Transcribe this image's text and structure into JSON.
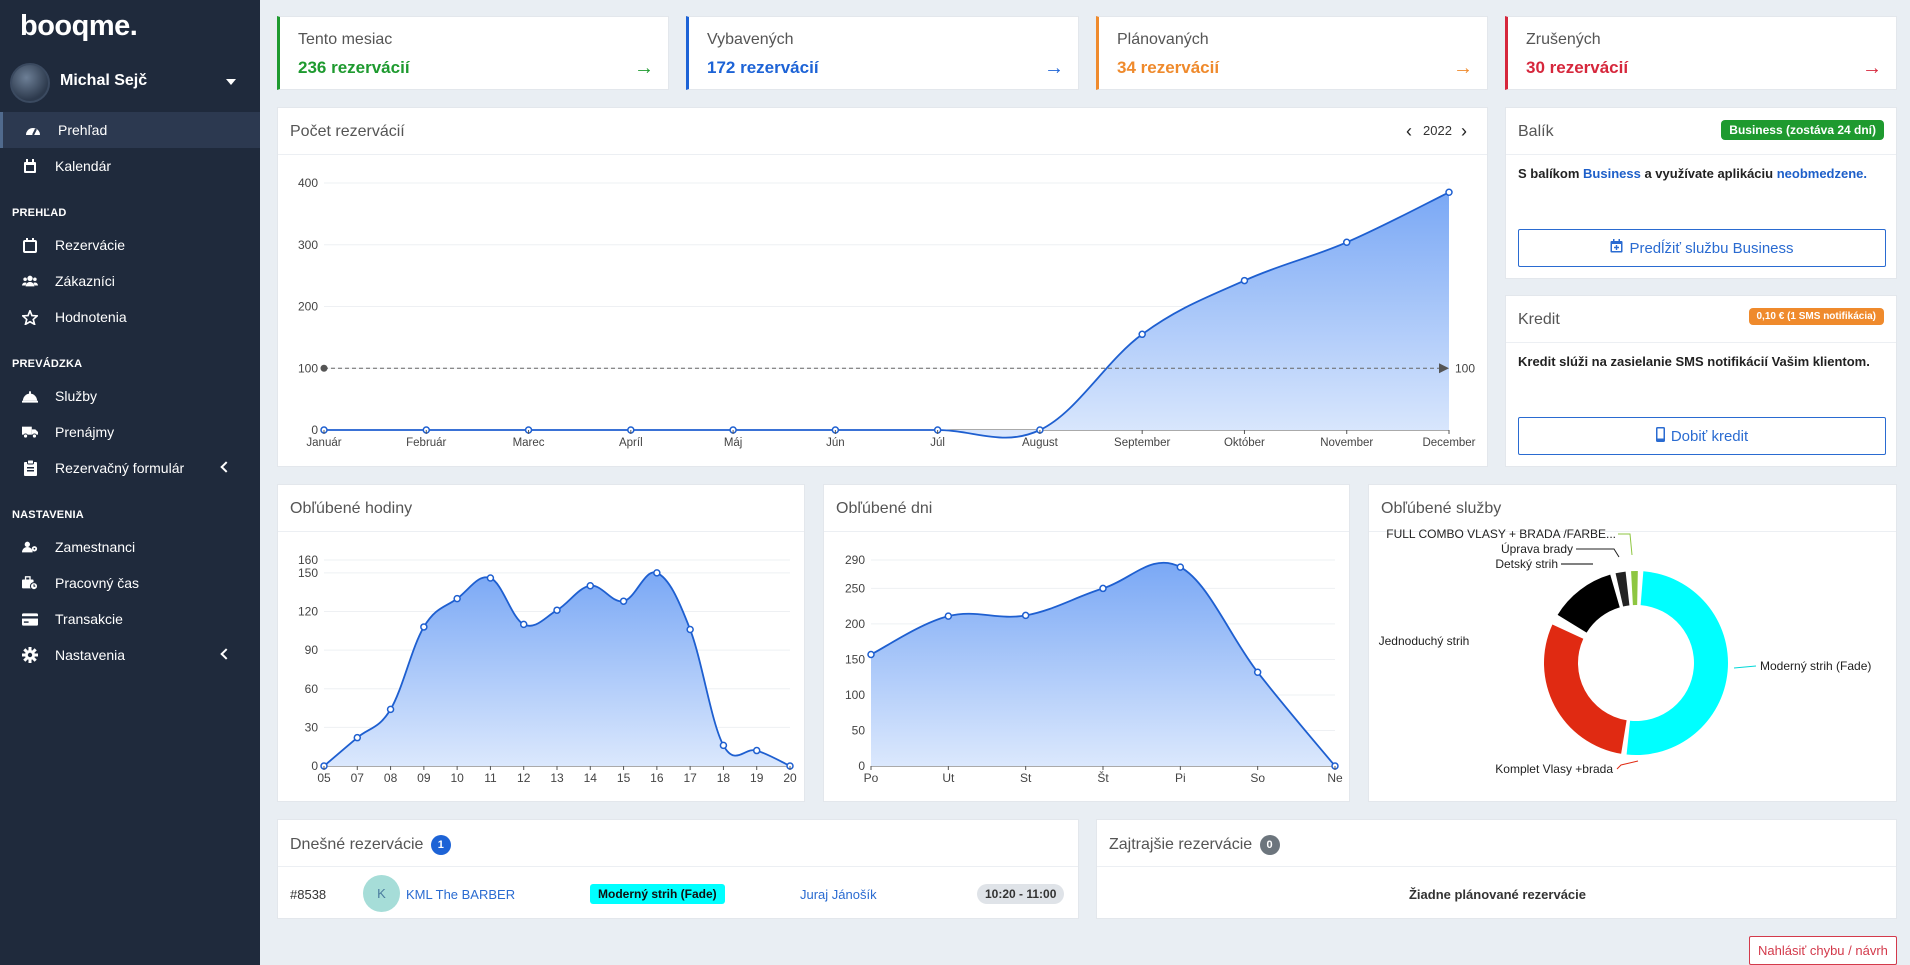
{
  "app": {
    "logo": "booqme."
  },
  "user": {
    "name": "Michal Sejč"
  },
  "nav": {
    "overview": "Prehľad",
    "calendar": "Kalendár",
    "section1": "PREHĽAD",
    "reservations": "Rezervácie",
    "customers": "Zákazníci",
    "ratings": "Hodnotenia",
    "section2": "PREVÁDZKA",
    "services": "Služby",
    "rentals": "Prenájmy",
    "form": "Rezervačný formulár",
    "section3": "NASTAVENIA",
    "employees": "Zamestnanci",
    "worktime": "Pracovný čas",
    "transactions": "Transakcie",
    "settings": "Nastavenia"
  },
  "stats": [
    {
      "title": "Tento mesiac",
      "value": "236 rezervácií",
      "color": "#1e9a2f"
    },
    {
      "title": "Vybavených",
      "value": "172 rezervácií",
      "color": "#1d63d6"
    },
    {
      "title": "Plánovaných",
      "value": "34 rezervácií",
      "color": "#ef8a2c"
    },
    {
      "title": "Zrušených",
      "value": "30 rezervácií",
      "color": "#d6273c"
    }
  ],
  "main_chart": {
    "title": "Počet rezervácií",
    "year": "2022",
    "ref_label": "100"
  },
  "package": {
    "title": "Balík",
    "badge": "Business (zostáva 24 dní)",
    "text1": "S balíkom ",
    "text_bold1": "Business",
    "text2": " a využívate aplikáciu ",
    "text_bold2": "neobmedzene.",
    "button": "Predĺžiť službu Business"
  },
  "credit": {
    "title": "Kredit",
    "badge": "0,10 € (1 SMS notifikácia)",
    "text": "Kredit slúži na zasielanie SMS notifikácií Vašim klientom.",
    "button": "Dobiť kredit"
  },
  "hours_chart": {
    "title": "Obľúbené hodiny"
  },
  "days_chart": {
    "title": "Obľúbené dni"
  },
  "services_chart": {
    "title": "Obľúbené služby"
  },
  "today": {
    "title": "Dnešné rezervácie",
    "count": "1",
    "row": {
      "id": "#8538",
      "initial": "K",
      "name": "KML The BARBER",
      "service": "Moderný strih (Fade)",
      "customer": "Juraj Jánošík",
      "time": "10:20 - 11:00"
    }
  },
  "tomorrow": {
    "title": "Zajtrajšie rezervácie",
    "count": "0",
    "empty": "Žiadne plánované rezervácie"
  },
  "report_button": "Nahlásiť chybu / návrh",
  "colors": {
    "accent": "#1d63d6",
    "area": "#8ab4f8",
    "line": "#1e5fd0",
    "sidebar": "#1f2a3c"
  },
  "chart_data": [
    {
      "type": "area",
      "title": "Počet rezervácií",
      "categories": [
        "Január",
        "Február",
        "Marec",
        "Apríl",
        "Máj",
        "Jún",
        "Júl",
        "August",
        "September",
        "Október",
        "November",
        "December"
      ],
      "values": [
        0,
        0,
        0,
        0,
        0,
        0,
        0,
        0,
        155,
        242,
        304,
        385
      ],
      "yticks": [
        0,
        100,
        200,
        300,
        400
      ],
      "ylim": [
        0,
        400
      ],
      "reference_line": 100
    },
    {
      "type": "area",
      "title": "Obľúbené hodiny",
      "categories": [
        "05",
        "07",
        "08",
        "09",
        "10",
        "11",
        "12",
        "13",
        "14",
        "15",
        "16",
        "17",
        "18",
        "19",
        "20"
      ],
      "values": [
        0,
        22,
        44,
        108,
        130,
        146,
        110,
        121,
        140,
        128,
        150,
        106,
        16,
        12,
        0
      ],
      "yticks": [
        0,
        30,
        60,
        90,
        120,
        150,
        160
      ],
      "ylim": [
        0,
        160
      ]
    },
    {
      "type": "area",
      "title": "Obľúbené dni",
      "categories": [
        "Po",
        "Ut",
        "St",
        "Št",
        "Pi",
        "So",
        "Ne"
      ],
      "values": [
        157,
        211,
        212,
        250,
        280,
        132,
        0
      ],
      "yticks": [
        0,
        50,
        100,
        150,
        200,
        250,
        290
      ],
      "ylim": [
        0,
        290
      ]
    },
    {
      "type": "pie",
      "title": "Obľúbené služby",
      "labels": [
        "Moderný strih (Fade)",
        "Komplet Vlasy +brada",
        "Jednoduchý strih",
        "Detský strih",
        "Úprava brady",
        "FULL COMBO VLASY + BRADA /FARBE..."
      ],
      "values": [
        43,
        25,
        0,
        10,
        1.5,
        1
      ],
      "colors": [
        "#00ffff",
        "#e02a12",
        "#888888",
        "#000000",
        "#222222",
        "#8ec641"
      ]
    }
  ]
}
